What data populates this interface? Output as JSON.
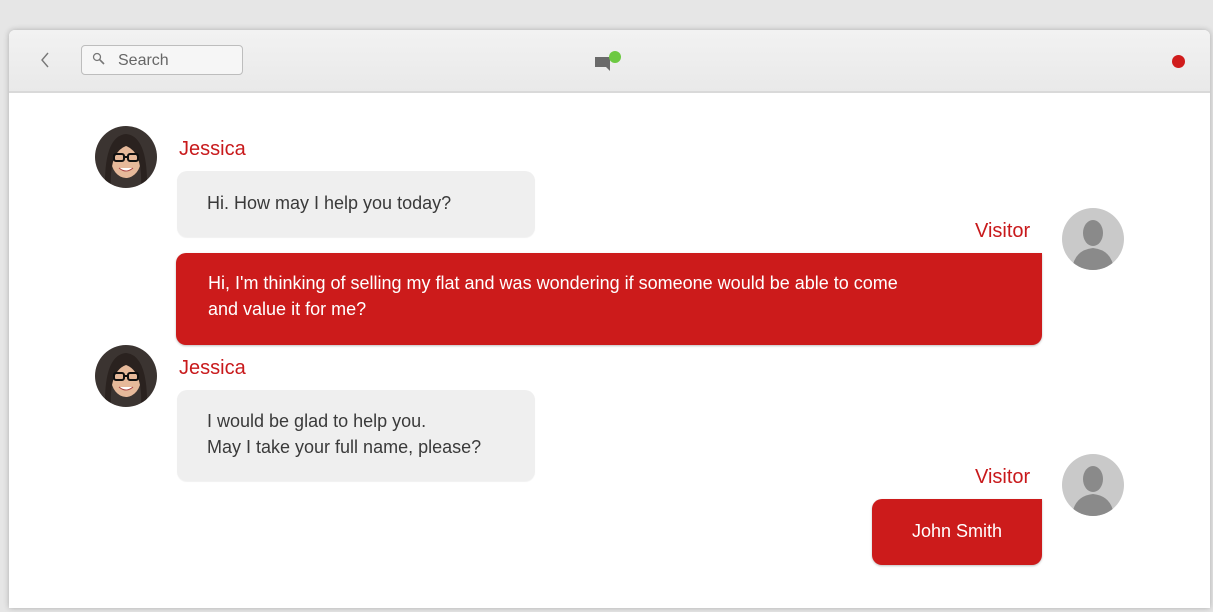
{
  "toolbar": {
    "back_icon": "chevron-left-icon",
    "search": {
      "placeholder": "Search",
      "value": "",
      "icon": "search-icon"
    },
    "chat_icon": "chat-bubble-icon",
    "online_status_color": "#6dc942",
    "record_indicator_color": "#d01c1c"
  },
  "colors": {
    "accent": "#cc1b1b",
    "agent_bubble": "#efefef",
    "name_text": "#c8191b"
  },
  "messages": [
    {
      "sender": "Jessica",
      "role": "agent",
      "lines": [
        "Hi. How may I help you today?"
      ]
    },
    {
      "sender": "Visitor",
      "role": "visitor",
      "lines": [
        "Hi, I'm thinking of selling my flat and was wondering if someone would be able to come",
        "and value it for me?"
      ]
    },
    {
      "sender": "Jessica",
      "role": "agent",
      "lines": [
        "I would be glad to help you.",
        "May I take your full name, please?"
      ]
    },
    {
      "sender": "Visitor",
      "role": "visitor",
      "lines": [
        "John Smith"
      ]
    }
  ]
}
